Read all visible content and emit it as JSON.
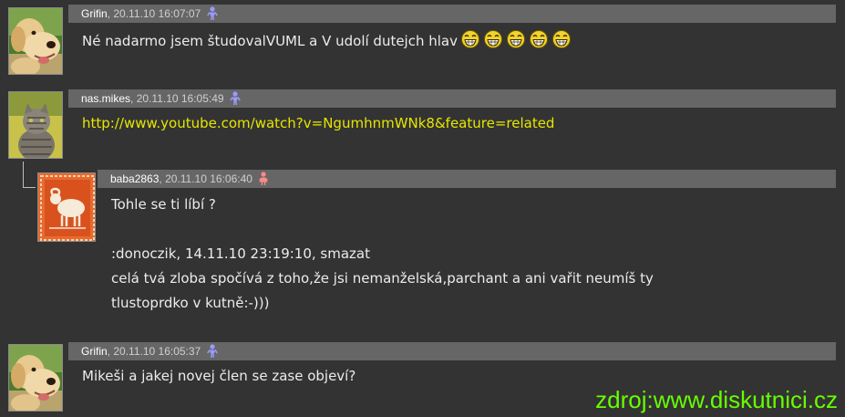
{
  "posts": [
    {
      "author": "Grifin",
      "date": "20.11.10 16:07:07",
      "gender": "male",
      "text": "Né nadarmo jsem študovalVUML a V udolí dutejch hlav",
      "smileys": [
        "laugh-smiley",
        "laugh-smiley",
        "laugh-smiley",
        "laugh-smiley",
        "laugh-smiley"
      ]
    },
    {
      "author": "nas.mikes",
      "date": "20.11.10 16:05:49",
      "gender": "male",
      "link": "http://www.youtube.com/watch?v=NgumhnmWNk8&feature=related"
    },
    {
      "author": "baba2863",
      "date": "20.11.10 16:06:40",
      "gender": "female",
      "lines": [
        "Tohle se ti líbí ?",
        "",
        ":donoczik, 14.11.10 23:19:10, smazat",
        "celá tvá zloba spočívá z toho,že jsi nemanželská,parchant a ani vařit neumíš ty",
        "tlustoprdko v kutně:-)))"
      ]
    },
    {
      "author": "Grifin",
      "date": "20.11.10 16:05:37",
      "gender": "male",
      "text": "Mikeši a jakej novej člen se zase objeví?"
    }
  ],
  "separator": ",",
  "watermark": "zdroj:www.diskutnici.cz",
  "colors": {
    "background": "#333333",
    "header": "#666666",
    "link": "#e6e600",
    "watermark": "#66ff00",
    "male_icon": "#9a9aff",
    "female_icon": "#ff8a8a"
  },
  "icons": {
    "avatar_grifin": "dog-avatar",
    "avatar_mikes": "cat-avatar",
    "avatar_baba": "ram-avatar",
    "male": "male-user-icon",
    "female": "female-user-icon",
    "smiley": "laugh-smiley"
  }
}
